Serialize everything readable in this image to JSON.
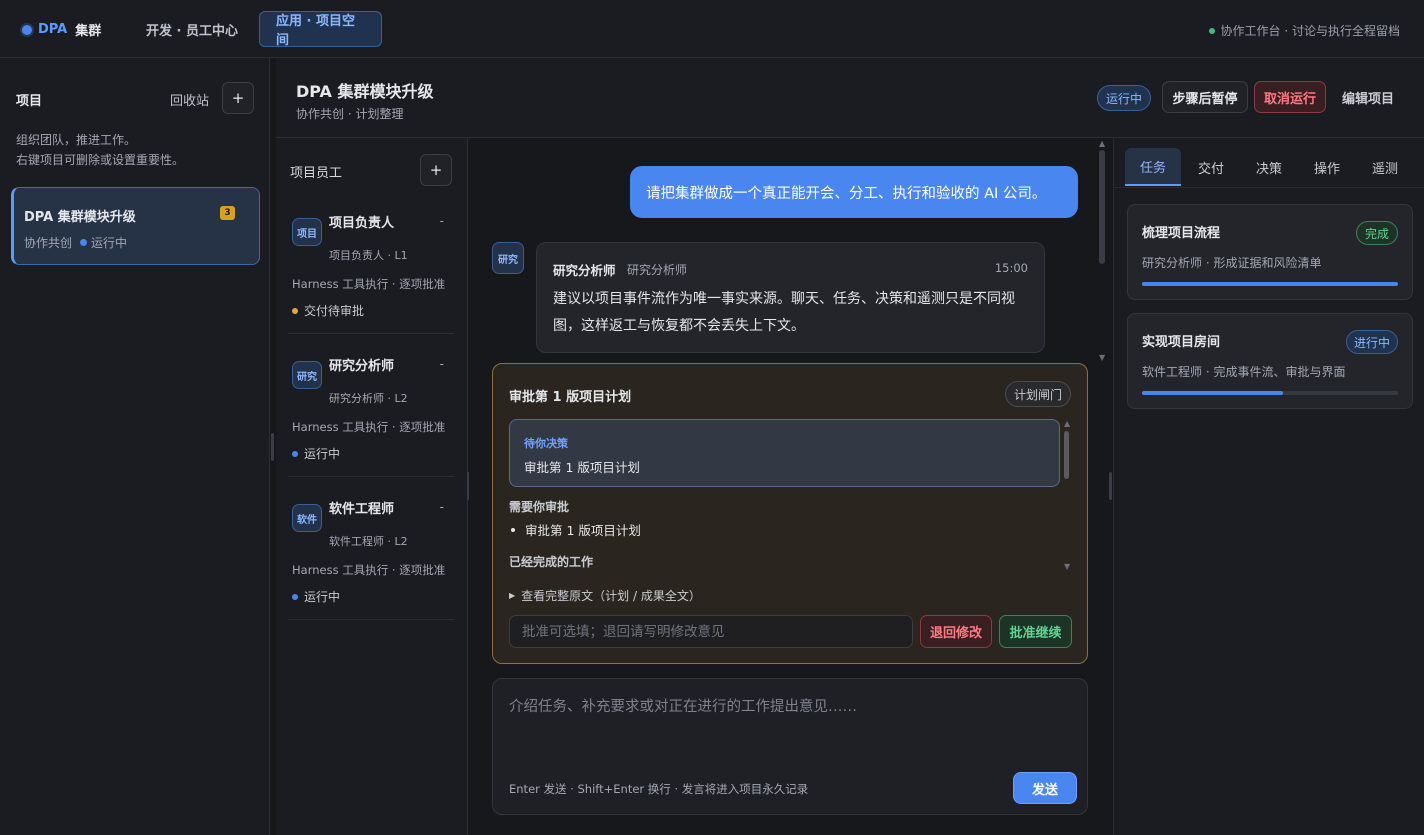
{
  "topbar": {
    "brand_prefix": "DPA",
    "brand_suffix": "集群",
    "nav": [
      "开发 · 员工中心",
      "应用 · 项目空间"
    ],
    "status": "协作工作台 · 讨论与执行全程留档"
  },
  "sidebar": {
    "title": "项目",
    "recycle_bin": "回收站",
    "add_label": "+",
    "desc_line1": "组织团队，推进工作。",
    "desc_line2": "右键项目可删除或设置重要性。",
    "project": {
      "name": "DPA 集群模块升级",
      "badge": "3",
      "mode": "协作共创",
      "status": "运行中"
    }
  },
  "header": {
    "title": "DPA 集群模块升级",
    "subtitle": "协作共创 · 计划整理",
    "status_pill": "运行中",
    "pause_label": "步骤后暂停",
    "cancel_label": "取消运行",
    "edit_label": "编辑项目"
  },
  "members": {
    "title": "项目员工",
    "add_label": "+",
    "list": [
      {
        "avatar": "项目",
        "name": "项目负责人",
        "dash": "-",
        "role": "项目负责人 · L1",
        "harness": "Harness 工具执行 · 逐项批准",
        "state": "交付待审批",
        "state_color": "#e3a93a"
      },
      {
        "avatar": "研究",
        "name": "研究分析师",
        "dash": "-",
        "role": "研究分析师 · L2",
        "harness": "Harness 工具执行 · 逐项批准",
        "state": "运行中",
        "state_color": "#4a86f0"
      },
      {
        "avatar": "软件",
        "name": "软件工程师",
        "dash": "-",
        "role": "软件工程师 · L2",
        "harness": "Harness 工具执行 · 逐项批准",
        "state": "运行中",
        "state_color": "#4a86f0"
      }
    ]
  },
  "chat": {
    "user_message": "请把集群做成一个真正能开会、分工、执行和验收的 AI 公司。",
    "agent": {
      "avatar": "研究",
      "name": "研究分析师",
      "role": "研究分析师",
      "time": "15:00",
      "text": "建议以项目事件流作为唯一事实来源。聊天、任务、决策和遥测只是不同视图，这样返工与恢复都不会丢失上下文。"
    },
    "approval": {
      "title": "审批第 1 版项目计划",
      "tag": "计划闸门",
      "decision_label": "待你决策",
      "decision_text": "审批第 1 版项目计划",
      "need_heading": "需要你审批",
      "need_item": "审批第 1 版项目计划",
      "done_heading": "已经完成的工作",
      "raw_toggle": "查看完整原文（计划 / 成果全文）",
      "input_placeholder": "批准可选填；退回请写明修改意见",
      "reject_label": "退回修改",
      "approve_label": "批准继续"
    },
    "composer": {
      "placeholder": "介绍任务、补充要求或对正在进行的工作提出意见……",
      "hint": "Enter 发送 · Shift+Enter 换行 · 发言将进入项目永久记录",
      "send_label": "发送"
    }
  },
  "right_panel": {
    "tabs": [
      "任务",
      "交付",
      "决策",
      "操作",
      "遥测"
    ],
    "active_tab": "任务",
    "tasks": [
      {
        "name": "梳理项目流程",
        "sub": "研究分析师 · 形成证据和风险清单",
        "status": "完成",
        "progress": 1.0
      },
      {
        "name": "实现项目房间",
        "sub": "软件工程师 · 完成事件流、审批与界面",
        "status": "进行中",
        "progress": 0.55
      }
    ]
  }
}
